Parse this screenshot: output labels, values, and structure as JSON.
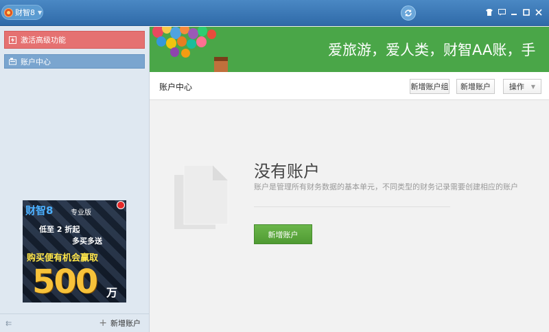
{
  "app": {
    "name": "财智8"
  },
  "colors": {
    "titlebar": "#3a77b6",
    "banner": "#4aa648",
    "primary": "#5aa83c",
    "activate": "#e57171",
    "nav_selected": "#7aa5cf"
  },
  "sidebar": {
    "activate_label": "激活高级功能",
    "account_center_label": "账户中心",
    "footer_add_label": "新增账户",
    "ad": {
      "brand": "财智8",
      "edition": "专业版",
      "line1": "低至 2 折起",
      "line2": "多买多送",
      "line3": "购买便有机会赢取",
      "amount": "500",
      "unit": "万"
    }
  },
  "banner": {
    "slogan": "爱旅游，爱人类，财智AA账，手"
  },
  "toolbar": {
    "title": "账户中心",
    "add_group": "新增账户组",
    "add_account": "新增账户",
    "operations": "操作"
  },
  "empty_state": {
    "title": "没有账户",
    "description": "账户是管理所有财务数据的基本单元，不同类型的财务记录需要创建相应的账户",
    "button": "新增账户"
  },
  "icons": [
    "app-logo-icon",
    "caret-down-icon",
    "sync-icon",
    "skin-icon",
    "message-icon",
    "minimize-icon",
    "maximize-icon",
    "close-icon",
    "lightning-icon",
    "account-icon",
    "collapse-icon",
    "plus-icon",
    "document-icon",
    "ad-close-icon"
  ]
}
